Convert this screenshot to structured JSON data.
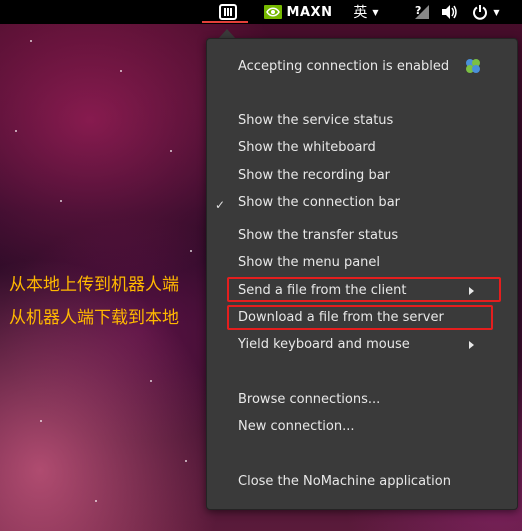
{
  "topbar": {
    "nomachine_icon": "nomachine-tray-icon",
    "maxn_label": "MAXN",
    "lang_label": "英",
    "lang_caret": "▼",
    "net_glyph": "?",
    "icons": [
      "network-icon",
      "volume-icon",
      "power-icon"
    ]
  },
  "menu": {
    "accepting": "Accepting connection is enabled",
    "show_service_status": "Show the service status",
    "show_whiteboard": "Show the whiteboard",
    "show_recording_bar": "Show the recording bar",
    "show_connection_bar": "Show the connection bar",
    "connection_bar_check": "✓",
    "show_transfer_status": "Show the transfer status",
    "show_menu_panel": "Show the menu panel",
    "send_file": "Send a file from the client",
    "download_file": "Download a file from the server",
    "yield": "Yield keyboard and mouse",
    "browse": "Browse connections...",
    "new_connection": "New connection...",
    "close_app": "Close the NoMachine application"
  },
  "annotations": {
    "upload_note": "从本地上传到机器人端",
    "download_note": "从机器人端下载到本地",
    "highlight_color": "#e41e1e",
    "note_color": "#ffb800"
  }
}
